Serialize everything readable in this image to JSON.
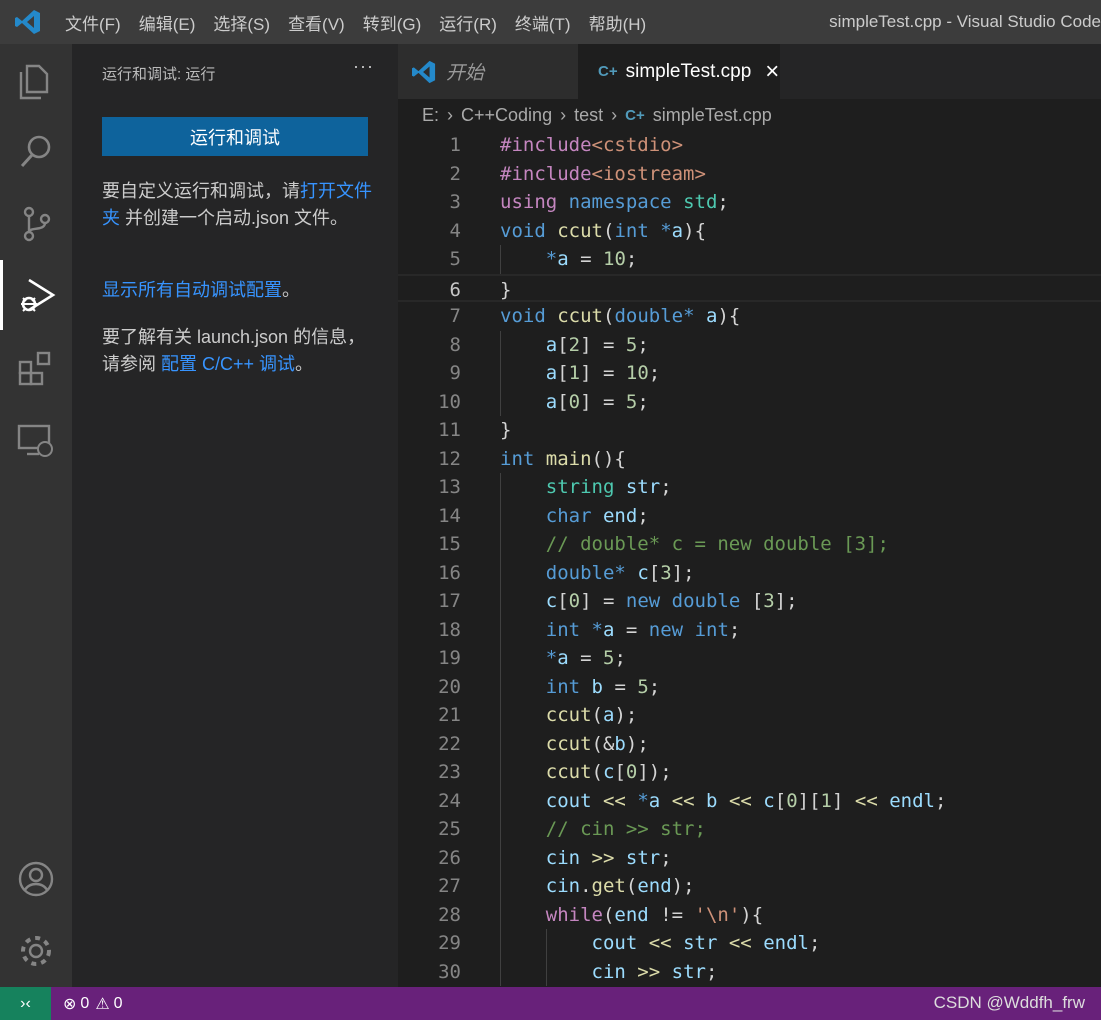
{
  "titlebar": {
    "menus": [
      "文件(F)",
      "编辑(E)",
      "选择(S)",
      "查看(V)",
      "转到(G)",
      "运行(R)",
      "终端(T)",
      "帮助(H)"
    ],
    "title": "simpleTest.cpp - Visual Studio Code"
  },
  "sidebar": {
    "title": "运行和调试: 运行",
    "more": "···",
    "run_button": "运行和调试",
    "p1_text": "要自定义运行和调试，请",
    "p1_link": "打开文件夹",
    "p1_rest": " 并创建一个启动.json 文件。",
    "p2_link": "显示所有自动调试配置",
    "p2_rest": "。",
    "p3_text": "要了解有关 launch.json 的信息，请参阅 ",
    "p3_link": "配置 C/C++ 调试",
    "p3_rest": "。"
  },
  "tabs": [
    {
      "label": "开始"
    },
    {
      "label": "simpleTest.cpp",
      "close": "×"
    }
  ],
  "breadcrumb": [
    "E:",
    "C++Coding",
    "test",
    "simpleTest.cpp"
  ],
  "editor": {
    "current_line": 6,
    "lines": [
      [
        [
          "c",
          "#include"
        ],
        [
          "s",
          "<cstdio>"
        ]
      ],
      [
        [
          "c",
          "#include"
        ],
        [
          "s",
          "<iostream>"
        ]
      ],
      [
        [
          "c",
          "using"
        ],
        [
          "",
          " "
        ],
        [
          "k",
          "namespace"
        ],
        [
          "",
          " "
        ],
        [
          "t",
          "std"
        ],
        [
          "",
          ";"
        ]
      ],
      [
        [
          "k",
          "void"
        ],
        [
          "",
          " "
        ],
        [
          "f",
          "ccut"
        ],
        [
          "",
          "("
        ],
        [
          "k",
          "int"
        ],
        [
          "",
          " "
        ],
        [
          "k",
          "*"
        ],
        [
          "v",
          "a"
        ],
        [
          "",
          "){"
        ]
      ],
      [
        [
          "",
          "    "
        ],
        [
          "k",
          "*"
        ],
        [
          "v",
          "a"
        ],
        [
          "",
          " = "
        ],
        [
          "n",
          "10"
        ],
        [
          "",
          ";"
        ]
      ],
      [
        [
          "",
          "}"
        ]
      ],
      [
        [
          "k",
          "void"
        ],
        [
          "",
          " "
        ],
        [
          "f",
          "ccut"
        ],
        [
          "",
          "("
        ],
        [
          "k",
          "double"
        ],
        [
          "k",
          "*"
        ],
        [
          "",
          " "
        ],
        [
          "v",
          "a"
        ],
        [
          "",
          "){"
        ]
      ],
      [
        [
          "",
          "    "
        ],
        [
          "v",
          "a"
        ],
        [
          "",
          "["
        ],
        [
          "n",
          "2"
        ],
        [
          "",
          "] = "
        ],
        [
          "n",
          "5"
        ],
        [
          "",
          ";"
        ]
      ],
      [
        [
          "",
          "    "
        ],
        [
          "v",
          "a"
        ],
        [
          "",
          "["
        ],
        [
          "n",
          "1"
        ],
        [
          "",
          "] = "
        ],
        [
          "n",
          "10"
        ],
        [
          "",
          ";"
        ]
      ],
      [
        [
          "",
          "    "
        ],
        [
          "v",
          "a"
        ],
        [
          "",
          "["
        ],
        [
          "n",
          "0"
        ],
        [
          "",
          "] = "
        ],
        [
          "n",
          "5"
        ],
        [
          "",
          ";"
        ]
      ],
      [
        [
          "",
          "}"
        ]
      ],
      [
        [
          "k",
          "int"
        ],
        [
          "",
          " "
        ],
        [
          "f",
          "main"
        ],
        [
          "",
          "(){"
        ]
      ],
      [
        [
          "",
          "    "
        ],
        [
          "t",
          "string"
        ],
        [
          "",
          " "
        ],
        [
          "v",
          "str"
        ],
        [
          "",
          ";"
        ]
      ],
      [
        [
          "",
          "    "
        ],
        [
          "k",
          "char"
        ],
        [
          "",
          " "
        ],
        [
          "v",
          "end"
        ],
        [
          "",
          ";"
        ]
      ],
      [
        [
          "",
          "    "
        ],
        [
          "m",
          "// double* c = new double [3];"
        ]
      ],
      [
        [
          "",
          "    "
        ],
        [
          "k",
          "double"
        ],
        [
          "k",
          "*"
        ],
        [
          "",
          " "
        ],
        [
          "v",
          "c"
        ],
        [
          "",
          "["
        ],
        [
          "n",
          "3"
        ],
        [
          "",
          "];"
        ]
      ],
      [
        [
          "",
          "    "
        ],
        [
          "v",
          "c"
        ],
        [
          "",
          "["
        ],
        [
          "n",
          "0"
        ],
        [
          "",
          "] = "
        ],
        [
          "k",
          "new"
        ],
        [
          "",
          " "
        ],
        [
          "k",
          "double"
        ],
        [
          "",
          " ["
        ],
        [
          "n",
          "3"
        ],
        [
          "",
          "];"
        ]
      ],
      [
        [
          "",
          "    "
        ],
        [
          "k",
          "int"
        ],
        [
          "",
          " "
        ],
        [
          "k",
          "*"
        ],
        [
          "v",
          "a"
        ],
        [
          "",
          " = "
        ],
        [
          "k",
          "new"
        ],
        [
          "",
          " "
        ],
        [
          "k",
          "int"
        ],
        [
          "",
          ";"
        ]
      ],
      [
        [
          "",
          "    "
        ],
        [
          "k",
          "*"
        ],
        [
          "v",
          "a"
        ],
        [
          "",
          " = "
        ],
        [
          "n",
          "5"
        ],
        [
          "",
          ";"
        ]
      ],
      [
        [
          "",
          "    "
        ],
        [
          "k",
          "int"
        ],
        [
          "",
          " "
        ],
        [
          "v",
          "b"
        ],
        [
          "",
          " = "
        ],
        [
          "n",
          "5"
        ],
        [
          "",
          ";"
        ]
      ],
      [
        [
          "",
          "    "
        ],
        [
          "f",
          "ccut"
        ],
        [
          "",
          "("
        ],
        [
          "v",
          "a"
        ],
        [
          "",
          ");"
        ]
      ],
      [
        [
          "",
          "    "
        ],
        [
          "f",
          "ccut"
        ],
        [
          "",
          "(&"
        ],
        [
          "v",
          "b"
        ],
        [
          "",
          ");"
        ]
      ],
      [
        [
          "",
          "    "
        ],
        [
          "f",
          "ccut"
        ],
        [
          "",
          "("
        ],
        [
          "v",
          "c"
        ],
        [
          "",
          "["
        ],
        [
          "n",
          "0"
        ],
        [
          "",
          "]);"
        ]
      ],
      [
        [
          "",
          "    "
        ],
        [
          "v",
          "cout"
        ],
        [
          "",
          " "
        ],
        [
          "f",
          "<<"
        ],
        [
          "",
          " "
        ],
        [
          "k",
          "*"
        ],
        [
          "v",
          "a"
        ],
        [
          "",
          " "
        ],
        [
          "f",
          "<<"
        ],
        [
          "",
          " "
        ],
        [
          "v",
          "b"
        ],
        [
          "",
          " "
        ],
        [
          "f",
          "<<"
        ],
        [
          "",
          " "
        ],
        [
          "v",
          "c"
        ],
        [
          "",
          "["
        ],
        [
          "n",
          "0"
        ],
        [
          "",
          "]["
        ],
        [
          "n",
          "1"
        ],
        [
          "",
          "] "
        ],
        [
          "f",
          "<<"
        ],
        [
          "",
          " "
        ],
        [
          "v",
          "endl"
        ],
        [
          "",
          ";"
        ]
      ],
      [
        [
          "",
          "    "
        ],
        [
          "m",
          "// cin >> str;"
        ]
      ],
      [
        [
          "",
          "    "
        ],
        [
          "v",
          "cin"
        ],
        [
          "",
          " "
        ],
        [
          "f",
          ">>"
        ],
        [
          "",
          " "
        ],
        [
          "v",
          "str"
        ],
        [
          "",
          ";"
        ]
      ],
      [
        [
          "",
          "    "
        ],
        [
          "v",
          "cin"
        ],
        [
          "",
          "."
        ],
        [
          "f",
          "get"
        ],
        [
          "",
          "("
        ],
        [
          "v",
          "end"
        ],
        [
          "",
          ");"
        ]
      ],
      [
        [
          "",
          "    "
        ],
        [
          "c",
          "while"
        ],
        [
          "",
          "("
        ],
        [
          "v",
          "end"
        ],
        [
          "",
          " != "
        ],
        [
          "s",
          "'\\n'"
        ],
        [
          "",
          "){"
        ]
      ],
      [
        [
          "",
          "        "
        ],
        [
          "v",
          "cout"
        ],
        [
          "",
          " "
        ],
        [
          "f",
          "<<"
        ],
        [
          "",
          " "
        ],
        [
          "v",
          "str"
        ],
        [
          "",
          " "
        ],
        [
          "f",
          "<<"
        ],
        [
          "",
          " "
        ],
        [
          "v",
          "endl"
        ],
        [
          "",
          ";"
        ]
      ],
      [
        [
          "",
          "        "
        ],
        [
          "v",
          "cin"
        ],
        [
          "",
          " "
        ],
        [
          "f",
          ">>"
        ],
        [
          "",
          " "
        ],
        [
          "v",
          "str"
        ],
        [
          "",
          ";"
        ]
      ]
    ]
  },
  "statusbar": {
    "errors": "0",
    "warnings": "0",
    "watermark": "CSDN @Wddfh_frw"
  },
  "colors": {
    "accent": "#0e639c",
    "status": "#68217a",
    "remote": "#16825d"
  }
}
